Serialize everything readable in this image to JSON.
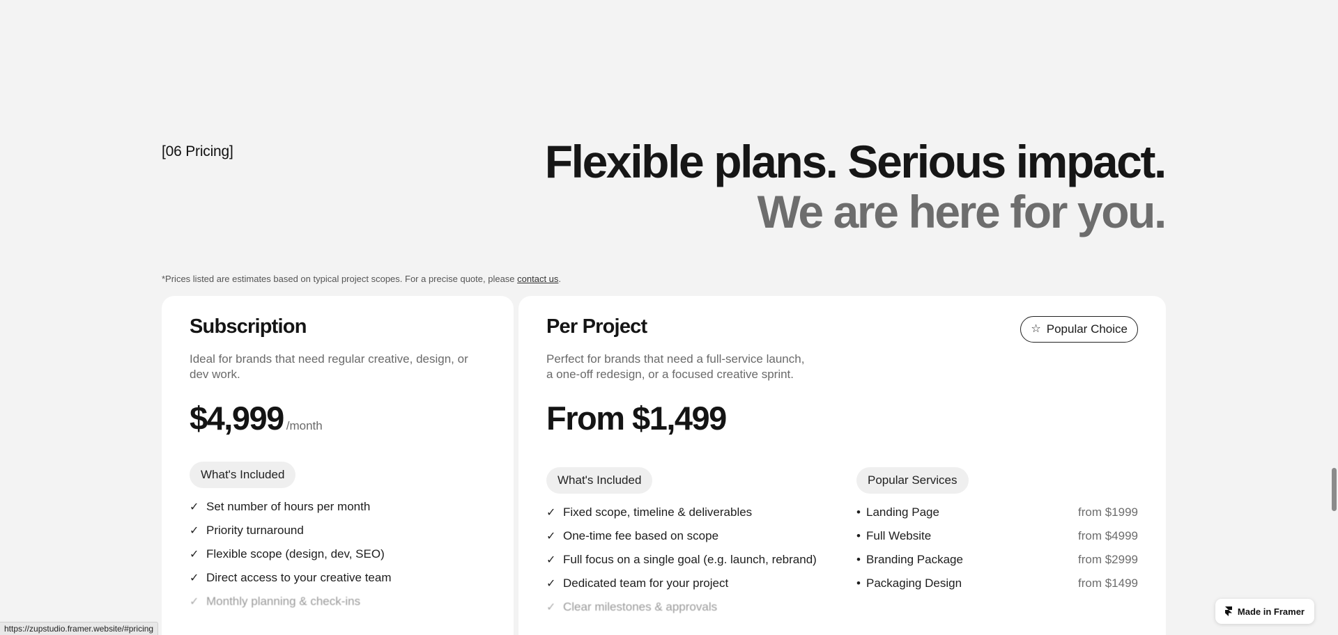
{
  "section": {
    "label": "[06 Pricing]"
  },
  "headline": {
    "line1": "Flexible plans. Serious impact.",
    "line2": "We are here for you."
  },
  "disclaimer": {
    "text": "*Prices listed are estimates based on typical project scopes. For a precise quote, please ",
    "link": "contact us",
    "end": "."
  },
  "subscription": {
    "title": "Subscription",
    "description": "Ideal for brands that need regular creative, design, or dev work.",
    "price": "$4,999",
    "per": "/month",
    "included_label": "What's Included",
    "features": [
      "Set number of hours per month",
      "Priority turnaround",
      "Flexible scope (design, dev, SEO)",
      "Direct access to your creative team",
      "Monthly planning & check-ins"
    ]
  },
  "project": {
    "title": "Per Project",
    "badge": "Popular Choice",
    "description": "Perfect for brands that need a full-service launch, a one-off redesign, or a focused creative sprint.",
    "price": "From $1,499",
    "included_label": "What's Included",
    "services_label": "Popular Services",
    "features": [
      "Fixed scope, timeline & deliverables",
      "One-time fee based on scope",
      "Full focus on a single goal (e.g. launch, rebrand)",
      "Dedicated team for your project",
      "Clear milestones & approvals"
    ],
    "services": [
      {
        "name": "Landing Page",
        "price": "from $1999"
      },
      {
        "name": "Full Website",
        "price": "from $4999"
      },
      {
        "name": "Branding Package",
        "price": "from $2999"
      },
      {
        "name": "Packaging Design",
        "price": "from $1499"
      }
    ]
  },
  "status_url": "https://zupstudio.framer.website/#pricing",
  "framer_badge": "Made in Framer",
  "icons": {
    "check": "checkmark-icon",
    "star": "star-icon",
    "framer": "framer-logo-icon"
  },
  "scroll_position": 0.74
}
